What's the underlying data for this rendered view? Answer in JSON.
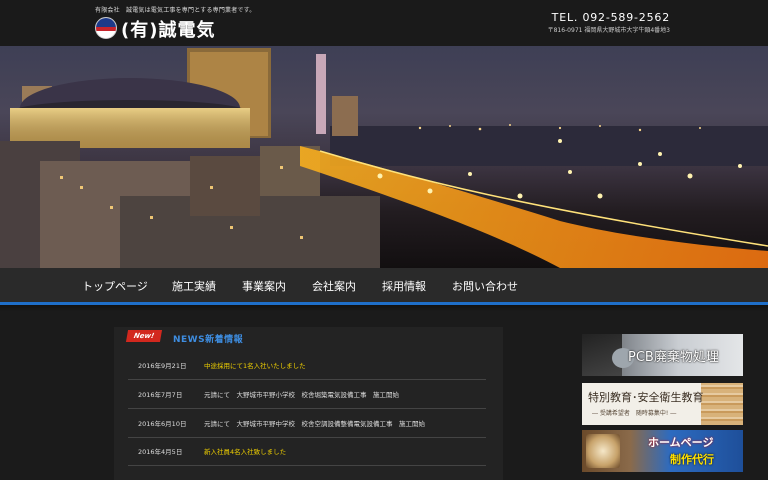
{
  "header": {
    "tagline": "有限会社　誠電気は電気工事を専門とする専門業者です。",
    "company_name": "(有)誠電気",
    "tel": "TEL. 092-589-2562",
    "address": "〒816-0971 福岡県大野城市大字牛頸4番地3"
  },
  "nav": {
    "items": [
      "トップページ",
      "施工実績",
      "事業案内",
      "会社案内",
      "採用情報",
      "お問い合わせ"
    ]
  },
  "news": {
    "badge": "New!",
    "title": "NEWS新着情報",
    "items": [
      {
        "date": "2016年9月21日",
        "text": "中途採用にて1名入社いたしました"
      },
      {
        "date": "2016年7月7日",
        "text": "元請にて　大野城市平野小学校　校舎堀築電気設備工事　施工開始"
      },
      {
        "date": "2016年6月10日",
        "text": "元請にて　大野城市平野中学校　校舎空調設備整備電気設備工事　施工開始"
      },
      {
        "date": "2016年4月5日",
        "text": "新入社員4名入社致しました"
      }
    ]
  },
  "banners": {
    "pcb": "PCB廃棄物処理",
    "education": "特別教育･安全衛生教育",
    "education_sub": "― 受講希望者　随時募集中! ―",
    "homepage_line1": "ホームページ",
    "homepage_line2": "制作代行"
  },
  "colors": {
    "nav_accent": "#1f6fc9",
    "news_title": "#3e8de0",
    "news_highlight": "#f0d000",
    "badge": "#d2281e"
  }
}
